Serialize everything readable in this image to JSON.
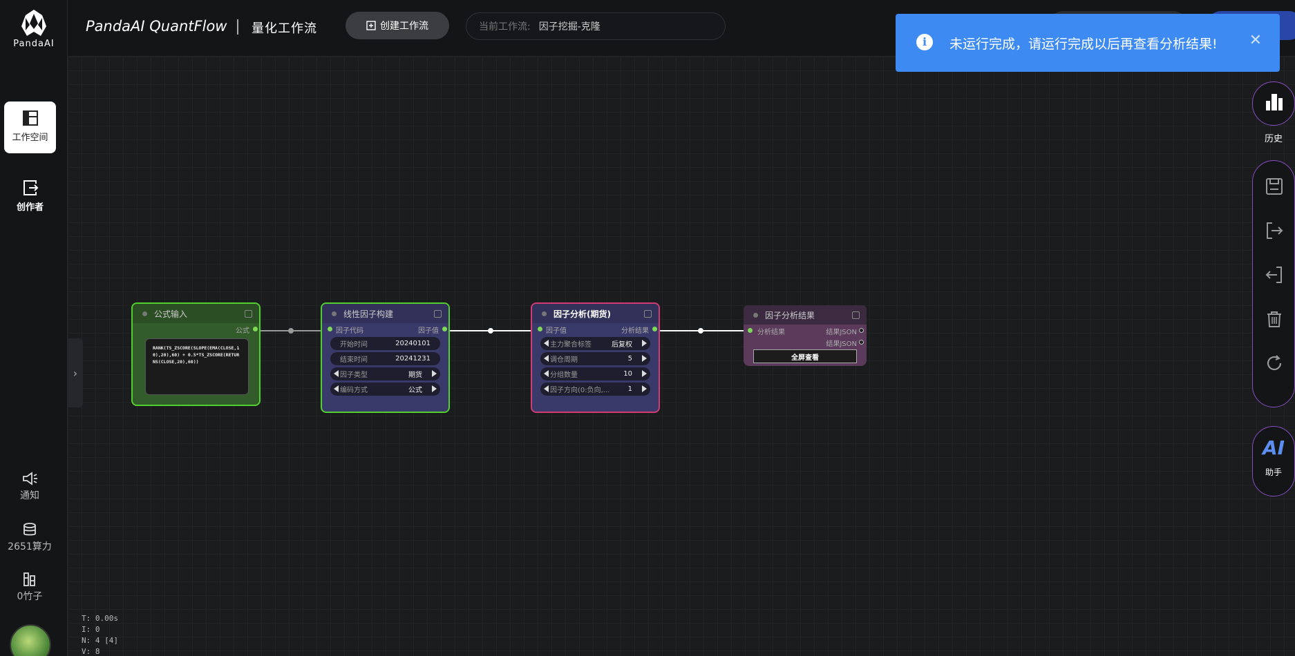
{
  "brand": {
    "logo_text": "PandaAI"
  },
  "sidebar": {
    "items": [
      {
        "label": "工作空间",
        "icon": "workspace-icon"
      },
      {
        "label": "创作者",
        "icon": "creator-icon"
      }
    ],
    "bottom": [
      {
        "label": "通知",
        "icon": "megaphone-icon"
      },
      {
        "label": "2651算力",
        "icon": "coins-icon"
      },
      {
        "label": "0竹子",
        "icon": "bamboo-icon"
      }
    ]
  },
  "header": {
    "title": "PandaAI QuantFlow",
    "subtitle": "量化工作流",
    "create_button": "创建工作流",
    "workflow_label": "当前工作流:",
    "workflow_value": "因子挖掘-克隆"
  },
  "toast": {
    "message": "未运行完成，请运行完成以后再查看分析结果!",
    "icon": "info-icon",
    "close": "✕"
  },
  "right_rail": {
    "history_label": "历史",
    "ai_text": "AI",
    "ai_label": "助手",
    "tools": [
      "save-icon",
      "export-icon",
      "import-icon",
      "delete-icon",
      "refresh-icon"
    ]
  },
  "stats": {
    "t": "T: 0.00s",
    "i": "I: 0",
    "n": "N: 4 [4]",
    "v": "V: 8"
  },
  "nodes": {
    "formula": {
      "title": "公式输入",
      "output": "公式",
      "code": "RANK(TS_ZSCORE(SLOPE(EMA(CLOSE,10),20),60) + 0.5*TS_ZSCORE(RETURNS(CLOSE,20),60))"
    },
    "factor_build": {
      "title": "线性因子构建",
      "input": "因子代码",
      "output": "因子值",
      "fields": [
        {
          "label": "开始时间",
          "value": "20240101"
        },
        {
          "label": "结束时间",
          "value": "20241231"
        },
        {
          "label": "因子类型",
          "value": "期货"
        },
        {
          "label": "编码方式",
          "value": "公式"
        }
      ]
    },
    "factor_analysis": {
      "title": "因子分析(期货)",
      "input": "因子值",
      "output": "分析结果",
      "fields": [
        {
          "label": "主力聚合标签",
          "value": "后复权"
        },
        {
          "label": "调仓周期",
          "value": "5"
        },
        {
          "label": "分组数量",
          "value": "10"
        },
        {
          "label": "因子方向(0:负向,...",
          "value": "1"
        }
      ]
    },
    "factor_result": {
      "title": "因子分析结果",
      "input": "分析结果",
      "outputs": [
        "结果JSON",
        "结果JSON"
      ],
      "button": "全屏查看"
    }
  },
  "colors": {
    "accent": "#3d8bf2",
    "node_ok": "#52d02f",
    "node_active": "#d23b74",
    "rail_border": "#8a4ec4"
  }
}
